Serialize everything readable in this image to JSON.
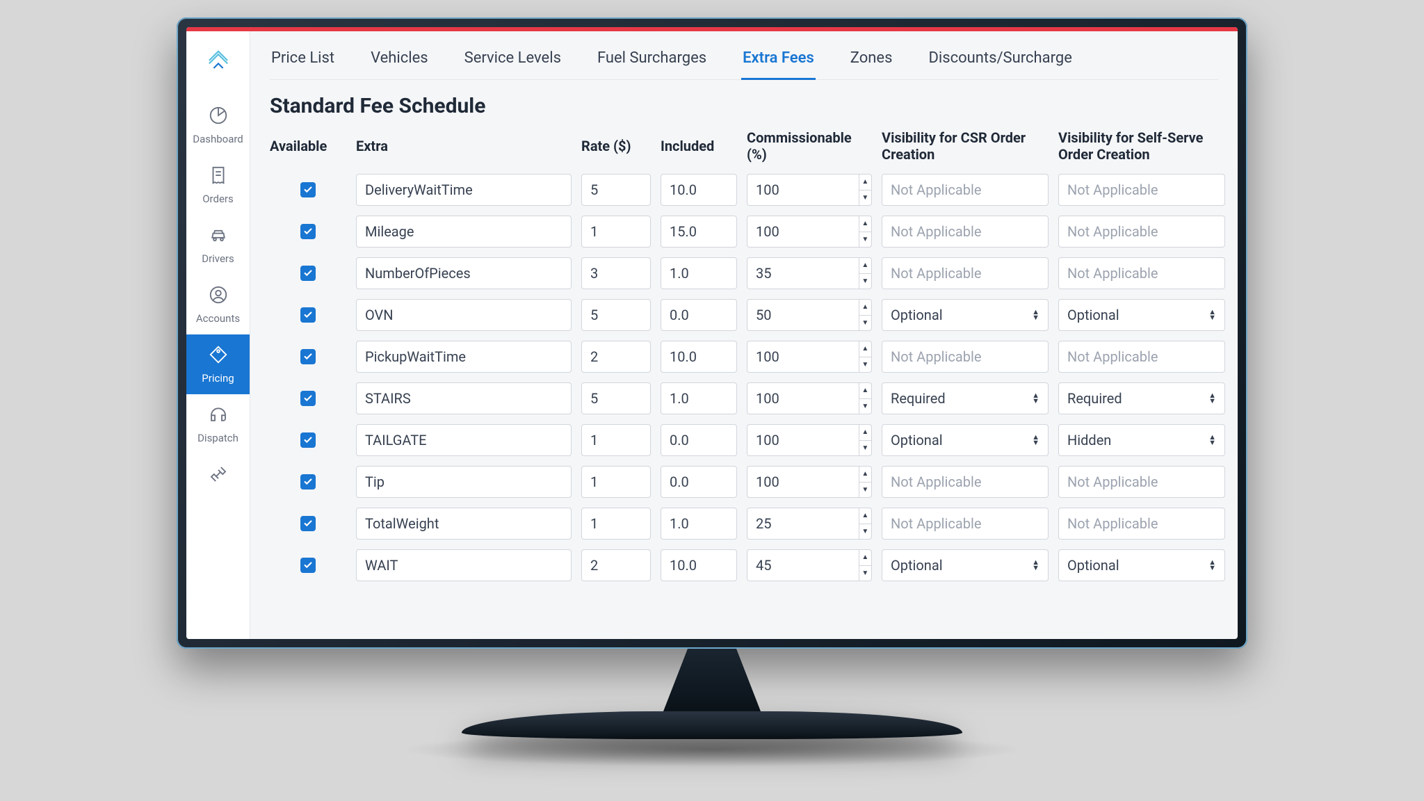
{
  "sidebar": {
    "items": [
      {
        "label": "Dashboard"
      },
      {
        "label": "Orders"
      },
      {
        "label": "Drivers"
      },
      {
        "label": "Accounts"
      },
      {
        "label": "Pricing"
      },
      {
        "label": "Dispatch"
      },
      {
        "label": "Settings"
      }
    ]
  },
  "tabs": [
    "Price List",
    "Vehicles",
    "Service Levels",
    "Fuel Surcharges",
    "Extra Fees",
    "Zones",
    "Discounts/Surcharge"
  ],
  "activeTab": "Extra Fees",
  "pageTitle": "Standard Fee Schedule",
  "columns": {
    "available": "Available",
    "extra": "Extra",
    "rate": "Rate ($)",
    "included": "Included",
    "commissionable": "Commissionable (%)",
    "visCSR": "Visibility for CSR Order Creation",
    "visSelf": "Visibility for Self-Serve Order Creation"
  },
  "rows": [
    {
      "available": true,
      "extra": "DeliveryWaitTime",
      "rate": "5",
      "included": "10.0",
      "commissionable": "100",
      "visCSR": "Not Applicable",
      "visSelf": "Not Applicable",
      "csrEnabled": false,
      "selfEnabled": false
    },
    {
      "available": true,
      "extra": "Mileage",
      "rate": "1",
      "included": "15.0",
      "commissionable": "100",
      "visCSR": "Not Applicable",
      "visSelf": "Not Applicable",
      "csrEnabled": false,
      "selfEnabled": false
    },
    {
      "available": true,
      "extra": "NumberOfPieces",
      "rate": "3",
      "included": "1.0",
      "commissionable": "35",
      "visCSR": "Not Applicable",
      "visSelf": "Not Applicable",
      "csrEnabled": false,
      "selfEnabled": false
    },
    {
      "available": true,
      "extra": "OVN",
      "rate": "5",
      "included": "0.0",
      "commissionable": "50",
      "visCSR": "Optional",
      "visSelf": "Optional",
      "csrEnabled": true,
      "selfEnabled": true
    },
    {
      "available": true,
      "extra": "PickupWaitTime",
      "rate": "2",
      "included": "10.0",
      "commissionable": "100",
      "visCSR": "Not Applicable",
      "visSelf": "Not Applicable",
      "csrEnabled": false,
      "selfEnabled": false
    },
    {
      "available": true,
      "extra": "STAIRS",
      "rate": "5",
      "included": "1.0",
      "commissionable": "100",
      "visCSR": "Required",
      "visSelf": "Required",
      "csrEnabled": true,
      "selfEnabled": true
    },
    {
      "available": true,
      "extra": "TAILGATE",
      "rate": "1",
      "included": "0.0",
      "commissionable": "100",
      "visCSR": "Optional",
      "visSelf": "Hidden",
      "csrEnabled": true,
      "selfEnabled": true
    },
    {
      "available": true,
      "extra": "Tip",
      "rate": "1",
      "included": "0.0",
      "commissionable": "100",
      "visCSR": "Not Applicable",
      "visSelf": "Not Applicable",
      "csrEnabled": false,
      "selfEnabled": false
    },
    {
      "available": true,
      "extra": "TotalWeight",
      "rate": "1",
      "included": "1.0",
      "commissionable": "25",
      "visCSR": "Not Applicable",
      "visSelf": "Not Applicable",
      "csrEnabled": false,
      "selfEnabled": false
    },
    {
      "available": true,
      "extra": "WAIT",
      "rate": "2",
      "included": "10.0",
      "commissionable": "45",
      "visCSR": "Optional",
      "visSelf": "Optional",
      "csrEnabled": true,
      "selfEnabled": true
    }
  ]
}
